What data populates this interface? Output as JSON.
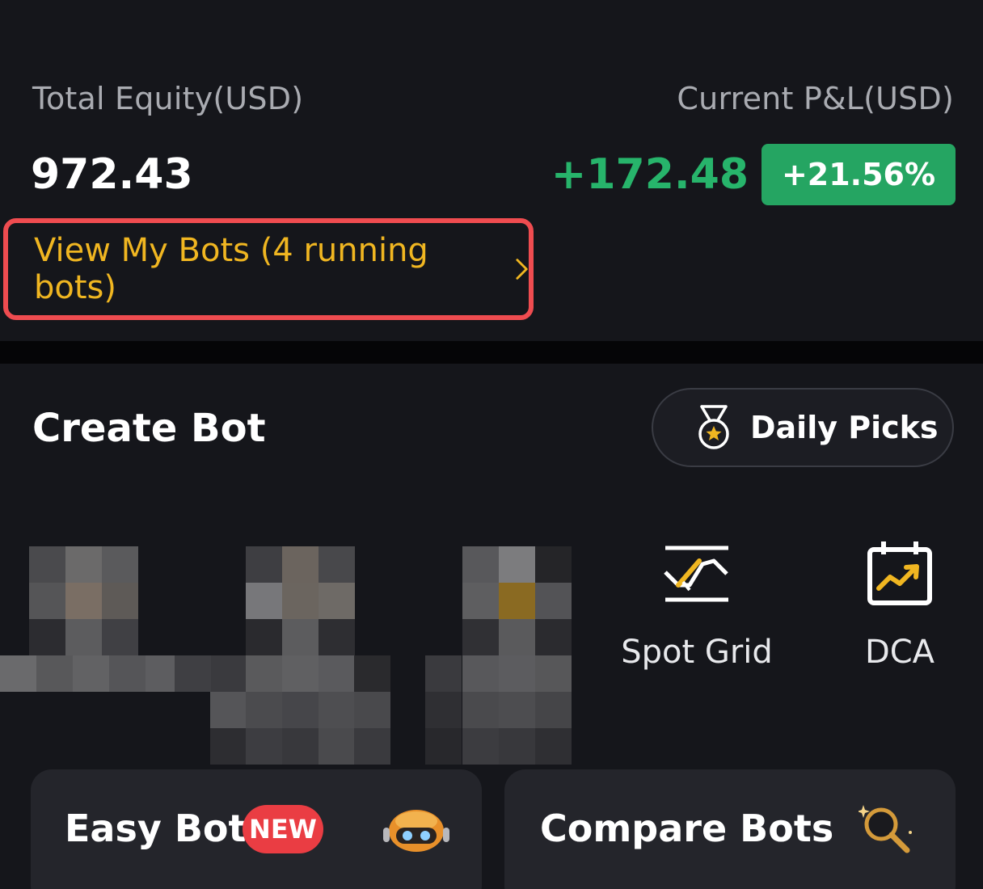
{
  "summary": {
    "total_equity_label": "Total Equity(USD)",
    "total_equity_value": "972.43",
    "pnl_label": "Current P&L(USD)",
    "pnl_value": "+172.48",
    "pnl_percent": "+21.56%",
    "view_bots_label": "View My Bots (4 running bots)"
  },
  "create_bot": {
    "title": "Create Bot",
    "daily_picks_label": "Daily Picks",
    "features": [
      {
        "label": "Spot Grid",
        "icon": "spot-grid-icon"
      },
      {
        "label": "DCA",
        "icon": "dca-calendar-icon"
      }
    ],
    "cards": [
      {
        "label": "Easy Bot",
        "badge": "NEW",
        "icon": "robot-icon"
      },
      {
        "label": "Compare Bots",
        "icon": "magnifier-icon"
      }
    ]
  },
  "colors": {
    "accent_gold": "#f0b621",
    "positive_green": "#27b46b",
    "highlight_red": "#ef4c50",
    "badge_red": "#ea3d43"
  }
}
